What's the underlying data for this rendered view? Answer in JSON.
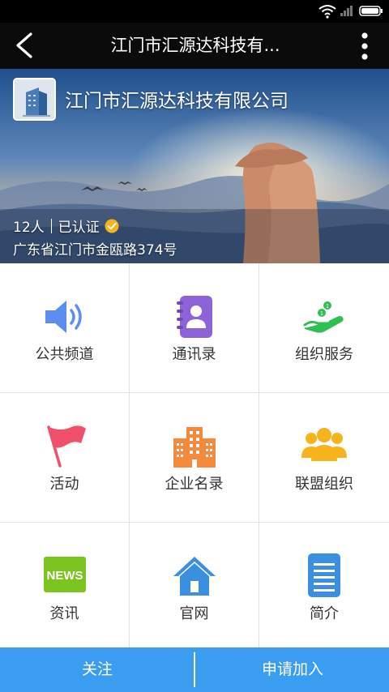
{
  "title_bar": {
    "title": "江门市汇源达科技有...",
    "back_icon": "back-arrow-icon",
    "more_icon": "more-vertical-icon"
  },
  "status_bar": {
    "icons": [
      "wifi-icon",
      "signal-icon",
      "battery-icon"
    ]
  },
  "banner": {
    "org_name": "江门市汇源达科技有限公司",
    "member_count": "12人",
    "verified_label": "已认证",
    "address": "广东省江门市金瓯路374号"
  },
  "grid": [
    {
      "label": "公共频道",
      "icon": "speaker-icon",
      "color": "#5b8ef0"
    },
    {
      "label": "通讯录",
      "icon": "contacts-book-icon",
      "color": "#8e63d9"
    },
    {
      "label": "组织服务",
      "icon": "hand-coins-icon",
      "color": "#2fbf55"
    },
    {
      "label": "活动",
      "icon": "flag-icon",
      "color": "#f0506a"
    },
    {
      "label": "企业名录",
      "icon": "building-icon",
      "color": "#f58a3c"
    },
    {
      "label": "联盟组织",
      "icon": "people-group-icon",
      "color": "#f5b41c"
    },
    {
      "label": "资讯",
      "icon": "news-icon",
      "color": "#7bc31f",
      "badge_text": "NEWS"
    },
    {
      "label": "官网",
      "icon": "house-icon",
      "color": "#3b8fe0"
    },
    {
      "label": "简介",
      "icon": "document-lines-icon",
      "color": "#3b8fe0"
    }
  ],
  "bottom_bar": {
    "follow_label": "关注",
    "join_label": "申请加入",
    "color": "#3a9df0"
  }
}
